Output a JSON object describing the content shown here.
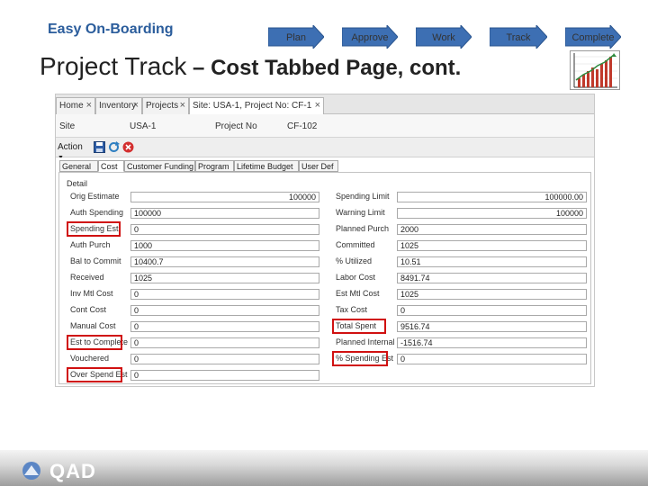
{
  "header": {
    "brand": "Easy On-Boarding",
    "title_main": "Project Track",
    "title_rest": " – Cost Tabbed Page, cont."
  },
  "steps": [
    "Plan",
    "Approve",
    "Work",
    "Track",
    "Complete"
  ],
  "app": {
    "doc_tabs": [
      "Home",
      "Inventory",
      "Projects",
      "Site: USA-1, Project No: CF-1"
    ],
    "info": {
      "site_label": "Site",
      "site_value": "USA-1",
      "project_label": "Project No",
      "project_value": "CF-102"
    },
    "toolbar": {
      "action_label": "Action"
    },
    "sub_tabs": [
      "General",
      "Cost",
      "Customer Funding",
      "Program",
      "Lifetime Budget",
      "User Def"
    ],
    "detail_legend": "Detail",
    "left_fields": [
      {
        "label": "Orig Estimate",
        "value": "100000"
      },
      {
        "label": "Auth Spending",
        "value": "100000"
      },
      {
        "label": "Spending Est",
        "value": "0"
      },
      {
        "label": "Auth Purch",
        "value": "1000"
      },
      {
        "label": "Bal to Commit",
        "value": "10400.7"
      },
      {
        "label": "Received",
        "value": "1025"
      },
      {
        "label": "Inv Mtl Cost",
        "value": "0"
      },
      {
        "label": "Cont Cost",
        "value": "0"
      },
      {
        "label": "Manual Cost",
        "value": "0"
      },
      {
        "label": "Est to Complete",
        "value": "0"
      },
      {
        "label": "Vouchered",
        "value": "0"
      },
      {
        "label": "Over Spend Est",
        "value": "0"
      }
    ],
    "right_fields": [
      {
        "label": "Spending Limit",
        "value": "100000.00"
      },
      {
        "label": "Warning Limit",
        "value": "100000"
      },
      {
        "label": "Planned Purch",
        "value": "2000"
      },
      {
        "label": "Committed",
        "value": "1025"
      },
      {
        "label": "% Utilized",
        "value": "10.51"
      },
      {
        "label": "Labor Cost",
        "value": "8491.74"
      },
      {
        "label": "Est Mtl Cost",
        "value": "1025"
      },
      {
        "label": "Tax Cost",
        "value": "0"
      },
      {
        "label": "Total Spent",
        "value": "9516.74"
      },
      {
        "label": "Planned Internal",
        "value": "-1516.74"
      },
      {
        "label": "% Spending Est",
        "value": "0"
      }
    ]
  },
  "footer": {
    "logo_text": "QAD"
  },
  "colors": {
    "brand": "#2b5d9c",
    "arrow": "#3d6fb3",
    "highlight": "#d01010"
  }
}
